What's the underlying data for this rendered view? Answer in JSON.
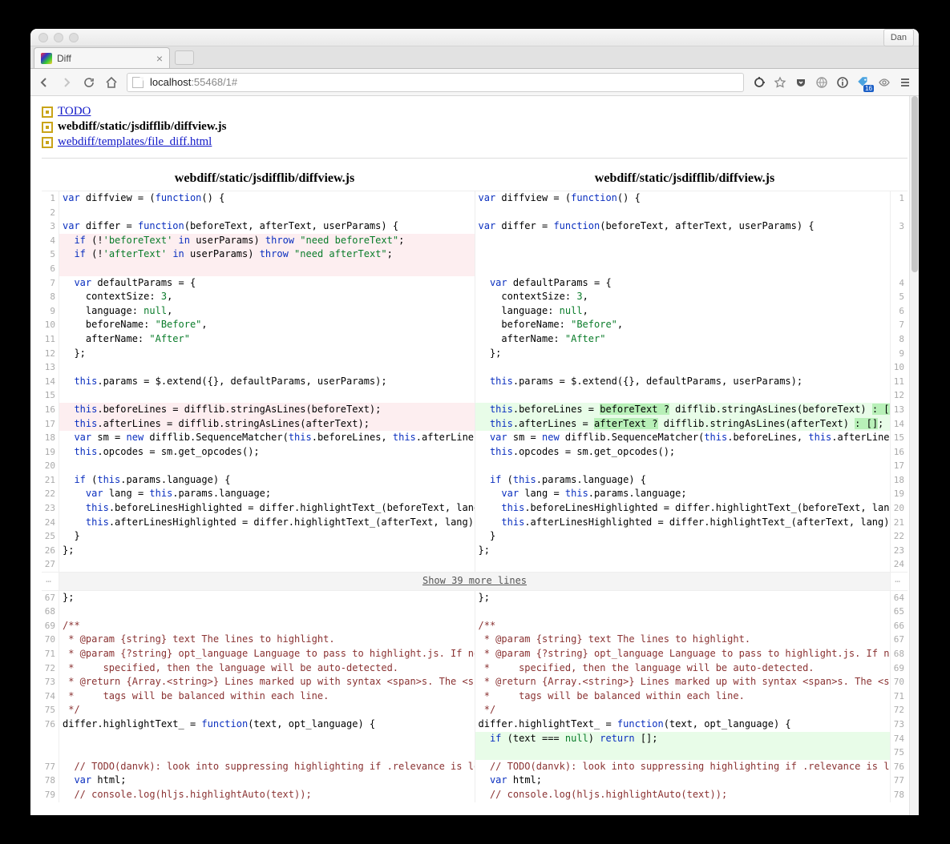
{
  "profile_name": "Dan",
  "tab": {
    "title": "Diff"
  },
  "url": {
    "host": "localhost",
    "rest": ":55468/1#"
  },
  "ext_badge": "16",
  "files": [
    {
      "label": "TODO",
      "link": true,
      "bold": false
    },
    {
      "label": "webdiff/static/jsdifflib/diffview.js",
      "link": false,
      "bold": true
    },
    {
      "label": "webdiff/templates/file_diff.html",
      "link": true,
      "bold": false
    }
  ],
  "header_left": "webdiff/static/jsdifflib/diffview.js",
  "header_right": "webdiff/static/jsdifflib/diffview.js",
  "skip_label": "Show 39 more lines",
  "diff_rows_top": [
    {
      "l": "1",
      "r": "1",
      "lhtml": "<span class='kw'>var</span> diffview = (<span class='kw'>function</span>() {",
      "rhtml": "<span class='kw'>var</span> diffview = (<span class='kw'>function</span>() {"
    },
    {
      "l": "2",
      "r": "",
      "lhtml": "",
      "rhtml": ""
    },
    {
      "l": "3",
      "r": "3",
      "lhtml": "<span class='kw'>var</span> differ = <span class='kw'>function</span>(beforeText, afterText, userParams) {",
      "rhtml": "<span class='kw'>var</span> differ = <span class='kw'>function</span>(beforeText, afterText, userParams) {"
    },
    {
      "l": "4",
      "r": "",
      "lcls": "del",
      "lhtml": "  <span class='kw'>if</span> (!<span class='str'>'beforeText'</span> <span class='kw'>in</span> userParams) <span class='kw'>throw</span> <span class='str'>\"need beforeText\"</span>;",
      "rhtml": ""
    },
    {
      "l": "5",
      "r": "",
      "lcls": "del",
      "lhtml": "  <span class='kw'>if</span> (!<span class='str'>'afterText'</span> <span class='kw'>in</span> userParams) <span class='kw'>throw</span> <span class='str'>\"need afterText\"</span>;",
      "rhtml": ""
    },
    {
      "l": "6",
      "r": "",
      "lcls": "del",
      "lhtml": "",
      "rhtml": ""
    },
    {
      "l": "7",
      "r": "4",
      "lhtml": "  <span class='kw'>var</span> defaultParams = {",
      "rhtml": "  <span class='kw'>var</span> defaultParams = {"
    },
    {
      "l": "8",
      "r": "5",
      "lhtml": "    contextSize: <span class='num'>3</span>,",
      "rhtml": "    contextSize: <span class='num'>3</span>,"
    },
    {
      "l": "9",
      "r": "6",
      "lhtml": "    language: <span class='lit'>null</span>,",
      "rhtml": "    language: <span class='lit'>null</span>,"
    },
    {
      "l": "10",
      "r": "7",
      "lhtml": "    beforeName: <span class='str'>\"Before\"</span>,",
      "rhtml": "    beforeName: <span class='str'>\"Before\"</span>,"
    },
    {
      "l": "11",
      "r": "8",
      "lhtml": "    afterName: <span class='str'>\"After\"</span>",
      "rhtml": "    afterName: <span class='str'>\"After\"</span>"
    },
    {
      "l": "12",
      "r": "9",
      "lhtml": "  };",
      "rhtml": "  };"
    },
    {
      "l": "13",
      "r": "10",
      "lhtml": "",
      "rhtml": ""
    },
    {
      "l": "14",
      "r": "11",
      "lhtml": "  <span class='kw'>this</span>.params = $.extend({}, defaultParams, userParams);",
      "rhtml": "  <span class='kw'>this</span>.params = $.extend({}, defaultParams, userParams);"
    },
    {
      "l": "15",
      "r": "12",
      "lhtml": "",
      "rhtml": ""
    },
    {
      "l": "16",
      "r": "13",
      "lcls": "del",
      "rcls": "ins",
      "lhtml": "  <span class='kw'>this</span>.beforeLines = difflib.stringAsLines(beforeText);",
      "rhtml": "  <span class='kw'>this</span>.beforeLines = <span class='inschar'>beforeText ?</span> difflib.stringAsLines(beforeText) <span class='inschar'>: []</span>;"
    },
    {
      "l": "17",
      "r": "14",
      "lcls": "del",
      "rcls": "ins",
      "lhtml": "  <span class='kw'>this</span>.afterLines = difflib.stringAsLines(afterText);",
      "rhtml": "  <span class='kw'>this</span>.afterLines = <span class='inschar'>afterText ?</span> difflib.stringAsLines(afterText) <span class='inschar'>: []</span>;"
    },
    {
      "l": "18",
      "r": "15",
      "lhtml": "  <span class='kw'>var</span> sm = <span class='kw'>new</span> difflib.SequenceMatcher(<span class='kw'>this</span>.beforeLines, <span class='kw'>this</span>.afterLines);",
      "rhtml": "  <span class='kw'>var</span> sm = <span class='kw'>new</span> difflib.SequenceMatcher(<span class='kw'>this</span>.beforeLines, <span class='kw'>this</span>.afterLines);"
    },
    {
      "l": "19",
      "r": "16",
      "lhtml": "  <span class='kw'>this</span>.opcodes = sm.get_opcodes();",
      "rhtml": "  <span class='kw'>this</span>.opcodes = sm.get_opcodes();"
    },
    {
      "l": "20",
      "r": "17",
      "lhtml": "",
      "rhtml": ""
    },
    {
      "l": "21",
      "r": "18",
      "lhtml": "  <span class='kw'>if</span> (<span class='kw'>this</span>.params.language) {",
      "rhtml": "  <span class='kw'>if</span> (<span class='kw'>this</span>.params.language) {"
    },
    {
      "l": "22",
      "r": "19",
      "lhtml": "    <span class='kw'>var</span> lang = <span class='kw'>this</span>.params.language;",
      "rhtml": "    <span class='kw'>var</span> lang = <span class='kw'>this</span>.params.language;"
    },
    {
      "l": "23",
      "r": "20",
      "lhtml": "    <span class='kw'>this</span>.beforeLinesHighlighted = differ.highlightText_(beforeText, lang);",
      "rhtml": "    <span class='kw'>this</span>.beforeLinesHighlighted = differ.highlightText_(beforeText, lang);"
    },
    {
      "l": "24",
      "r": "21",
      "lhtml": "    <span class='kw'>this</span>.afterLinesHighlighted = differ.highlightText_(afterText, lang);",
      "rhtml": "    <span class='kw'>this</span>.afterLinesHighlighted = differ.highlightText_(afterText, lang);"
    },
    {
      "l": "25",
      "r": "22",
      "lhtml": "  }",
      "rhtml": "  }"
    },
    {
      "l": "26",
      "r": "23",
      "lhtml": "};",
      "rhtml": "};"
    },
    {
      "l": "27",
      "r": "24",
      "lhtml": "",
      "rhtml": ""
    }
  ],
  "diff_rows_bottom": [
    {
      "l": "67",
      "r": "64",
      "lhtml": "};",
      "rhtml": "};"
    },
    {
      "l": "68",
      "r": "65",
      "lhtml": "",
      "rhtml": ""
    },
    {
      "l": "69",
      "r": "66",
      "lhtml": "<span class='cm'>/**</span>",
      "rhtml": "<span class='cm'>/**</span>"
    },
    {
      "l": "70",
      "r": "67",
      "lhtml": "<span class='cm'> * @param {string} text The lines to highlight.</span>",
      "rhtml": "<span class='cm'> * @param {string} text The lines to highlight.</span>"
    },
    {
      "l": "71",
      "r": "68",
      "lhtml": "<span class='cm'> * @param {?string} opt_language Language to pass to highlight.js. If not</span>",
      "rhtml": "<span class='cm'> * @param {?string} opt_language Language to pass to highlight.js. If not</span>"
    },
    {
      "l": "72",
      "r": "69",
      "lhtml": "<span class='cm'> *     specified, then the language will be auto-detected.</span>",
      "rhtml": "<span class='cm'> *     specified, then the language will be auto-detected.</span>"
    },
    {
      "l": "73",
      "r": "70",
      "lhtml": "<span class='cm'> * @return {Array.&lt;string&gt;} Lines marked up with syntax &lt;span&gt;s. The &lt;span&gt;</span>",
      "rhtml": "<span class='cm'> * @return {Array.&lt;string&gt;} Lines marked up with syntax &lt;span&gt;s. The &lt;span&gt;</span>"
    },
    {
      "l": "74",
      "r": "71",
      "lhtml": "<span class='cm'> *     tags will be balanced within each line.</span>",
      "rhtml": "<span class='cm'> *     tags will be balanced within each line.</span>"
    },
    {
      "l": "75",
      "r": "72",
      "lhtml": "<span class='cm'> */</span>",
      "rhtml": "<span class='cm'> */</span>"
    },
    {
      "l": "76",
      "r": "73",
      "lhtml": "differ.highlightText_ = <span class='kw'>function</span>(text, opt_language) {",
      "rhtml": "differ.highlightText_ = <span class='kw'>function</span>(text, opt_language) {"
    },
    {
      "l": "",
      "r": "74",
      "rcls": "ins",
      "lhtml": "",
      "rhtml": "  <span class='kw'>if</span> (text === <span class='lit'>null</span>) <span class='kw'>return</span> [];"
    },
    {
      "l": "",
      "r": "75",
      "rcls": "ins",
      "lhtml": "",
      "rhtml": ""
    },
    {
      "l": "77",
      "r": "76",
      "lhtml": "  <span class='cm'>// TODO(danvk): look into suppressing highlighting if .relevance is low.</span>",
      "rhtml": "  <span class='cm'>// TODO(danvk): look into suppressing highlighting if .relevance is low.</span>"
    },
    {
      "l": "78",
      "r": "77",
      "lhtml": "  <span class='kw'>var</span> html;",
      "rhtml": "  <span class='kw'>var</span> html;"
    },
    {
      "l": "79",
      "r": "78",
      "lhtml": "  <span class='cm'>// console.log(hljs.highlightAuto(text));</span>",
      "rhtml": "  <span class='cm'>// console.log(hljs.highlightAuto(text));</span>"
    }
  ]
}
